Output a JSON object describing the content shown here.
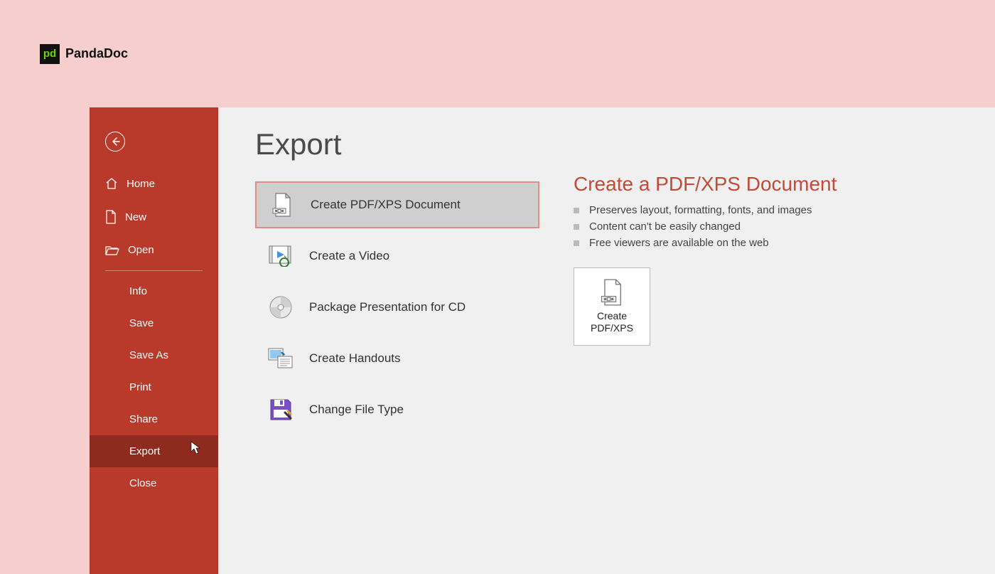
{
  "brand": {
    "name": "PandaDoc",
    "logo_text": "pd"
  },
  "sidebar": {
    "items": [
      {
        "label": "Home"
      },
      {
        "label": "New"
      },
      {
        "label": "Open"
      },
      {
        "label": "Info"
      },
      {
        "label": "Save"
      },
      {
        "label": "Save As"
      },
      {
        "label": "Print"
      },
      {
        "label": "Share"
      },
      {
        "label": "Export"
      },
      {
        "label": "Close"
      }
    ]
  },
  "page": {
    "title": "Export"
  },
  "export_options": [
    {
      "label": "Create PDF/XPS Document"
    },
    {
      "label": "Create a Video"
    },
    {
      "label": "Package Presentation for CD"
    },
    {
      "label": "Create Handouts"
    },
    {
      "label": "Change File Type"
    }
  ],
  "detail": {
    "title": "Create a PDF/XPS Document",
    "bullets": [
      "Preserves layout, formatting, fonts, and images",
      "Content can't be easily changed",
      "Free viewers are available on the web"
    ],
    "action_label_line1": "Create",
    "action_label_line2": "PDF/XPS"
  }
}
